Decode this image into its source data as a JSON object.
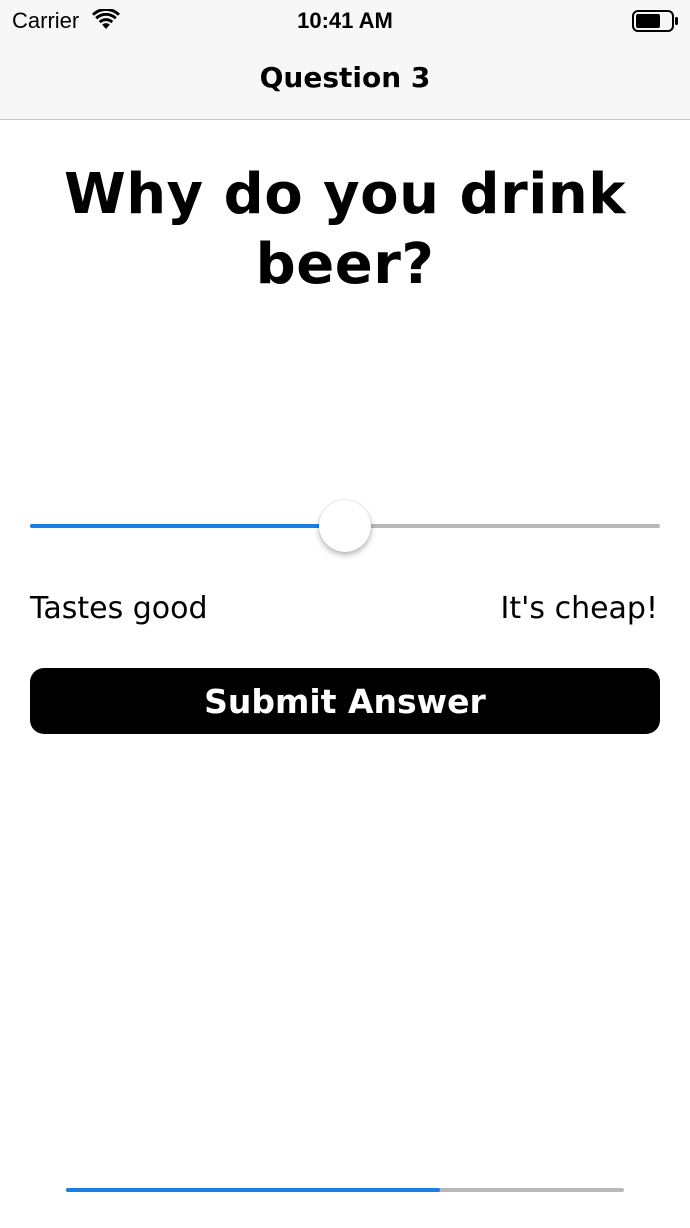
{
  "status_bar": {
    "carrier": "Carrier",
    "time": "10:41 AM",
    "icons": [
      "wifi-icon",
      "battery-icon"
    ]
  },
  "nav": {
    "title": "Question 3"
  },
  "question": {
    "text": "Why do you drink beer?"
  },
  "slider": {
    "value": 0.5,
    "min_label": "Tastes good",
    "max_label": "It's cheap!"
  },
  "submit": {
    "label": "Submit Answer"
  },
  "progress": {
    "value": 0.67
  },
  "colors": {
    "accent": "#1a7ee6",
    "track": "#b9b9b9",
    "button_bg": "#000000",
    "bar_bg": "#f7f7f7"
  }
}
